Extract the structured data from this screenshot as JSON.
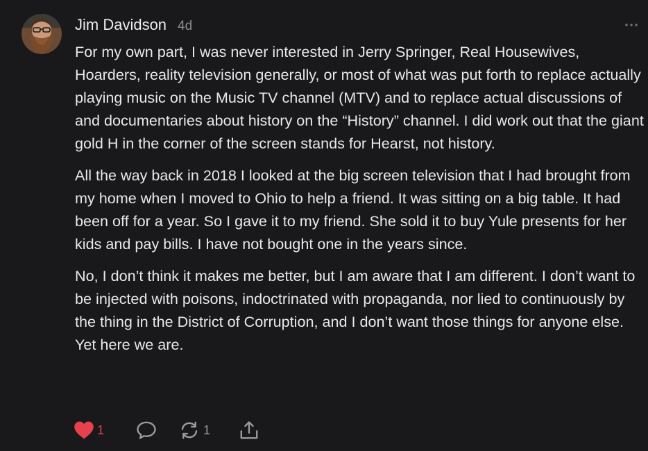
{
  "comment": {
    "author": "Jim Davidson",
    "timestamp": "4d",
    "paragraphs": [
      "For my own part, I was never interested in Jerry Springer, Real Housewives, Hoarders, reality television generally, or most of what was put forth to replace actually playing music on the Music TV channel (MTV) and to replace actual discussions of and documentaries about history on the “History” channel. I did work out that the giant gold H in the corner of the screen stands for Hearst, not history.",
      "All the way back in 2018 I looked at the big screen television that I had brought from my home when I moved to Ohio to help a friend. It was sitting on a big table. It had been off for a year. So I gave it to my friend. She sold it to buy Yule presents for her kids and pay bills. I have not bought one in the years since.",
      "No, I don’t think it makes me better, but I am aware that I am different. I don’t want to be injected with poisons, indoctrinated with propaganda, nor lied to continuously by the thing in the District of Corruption, and I don’t want those things for anyone else. Yet here we are."
    ]
  },
  "actions": {
    "like_count": "1",
    "restack_count": "1",
    "icons": [
      "heart-icon",
      "reply-icon",
      "restack-icon",
      "share-icon"
    ]
  },
  "colors": {
    "background": "#19191b",
    "like": "#e6414d",
    "muted": "#9a9aa0"
  }
}
